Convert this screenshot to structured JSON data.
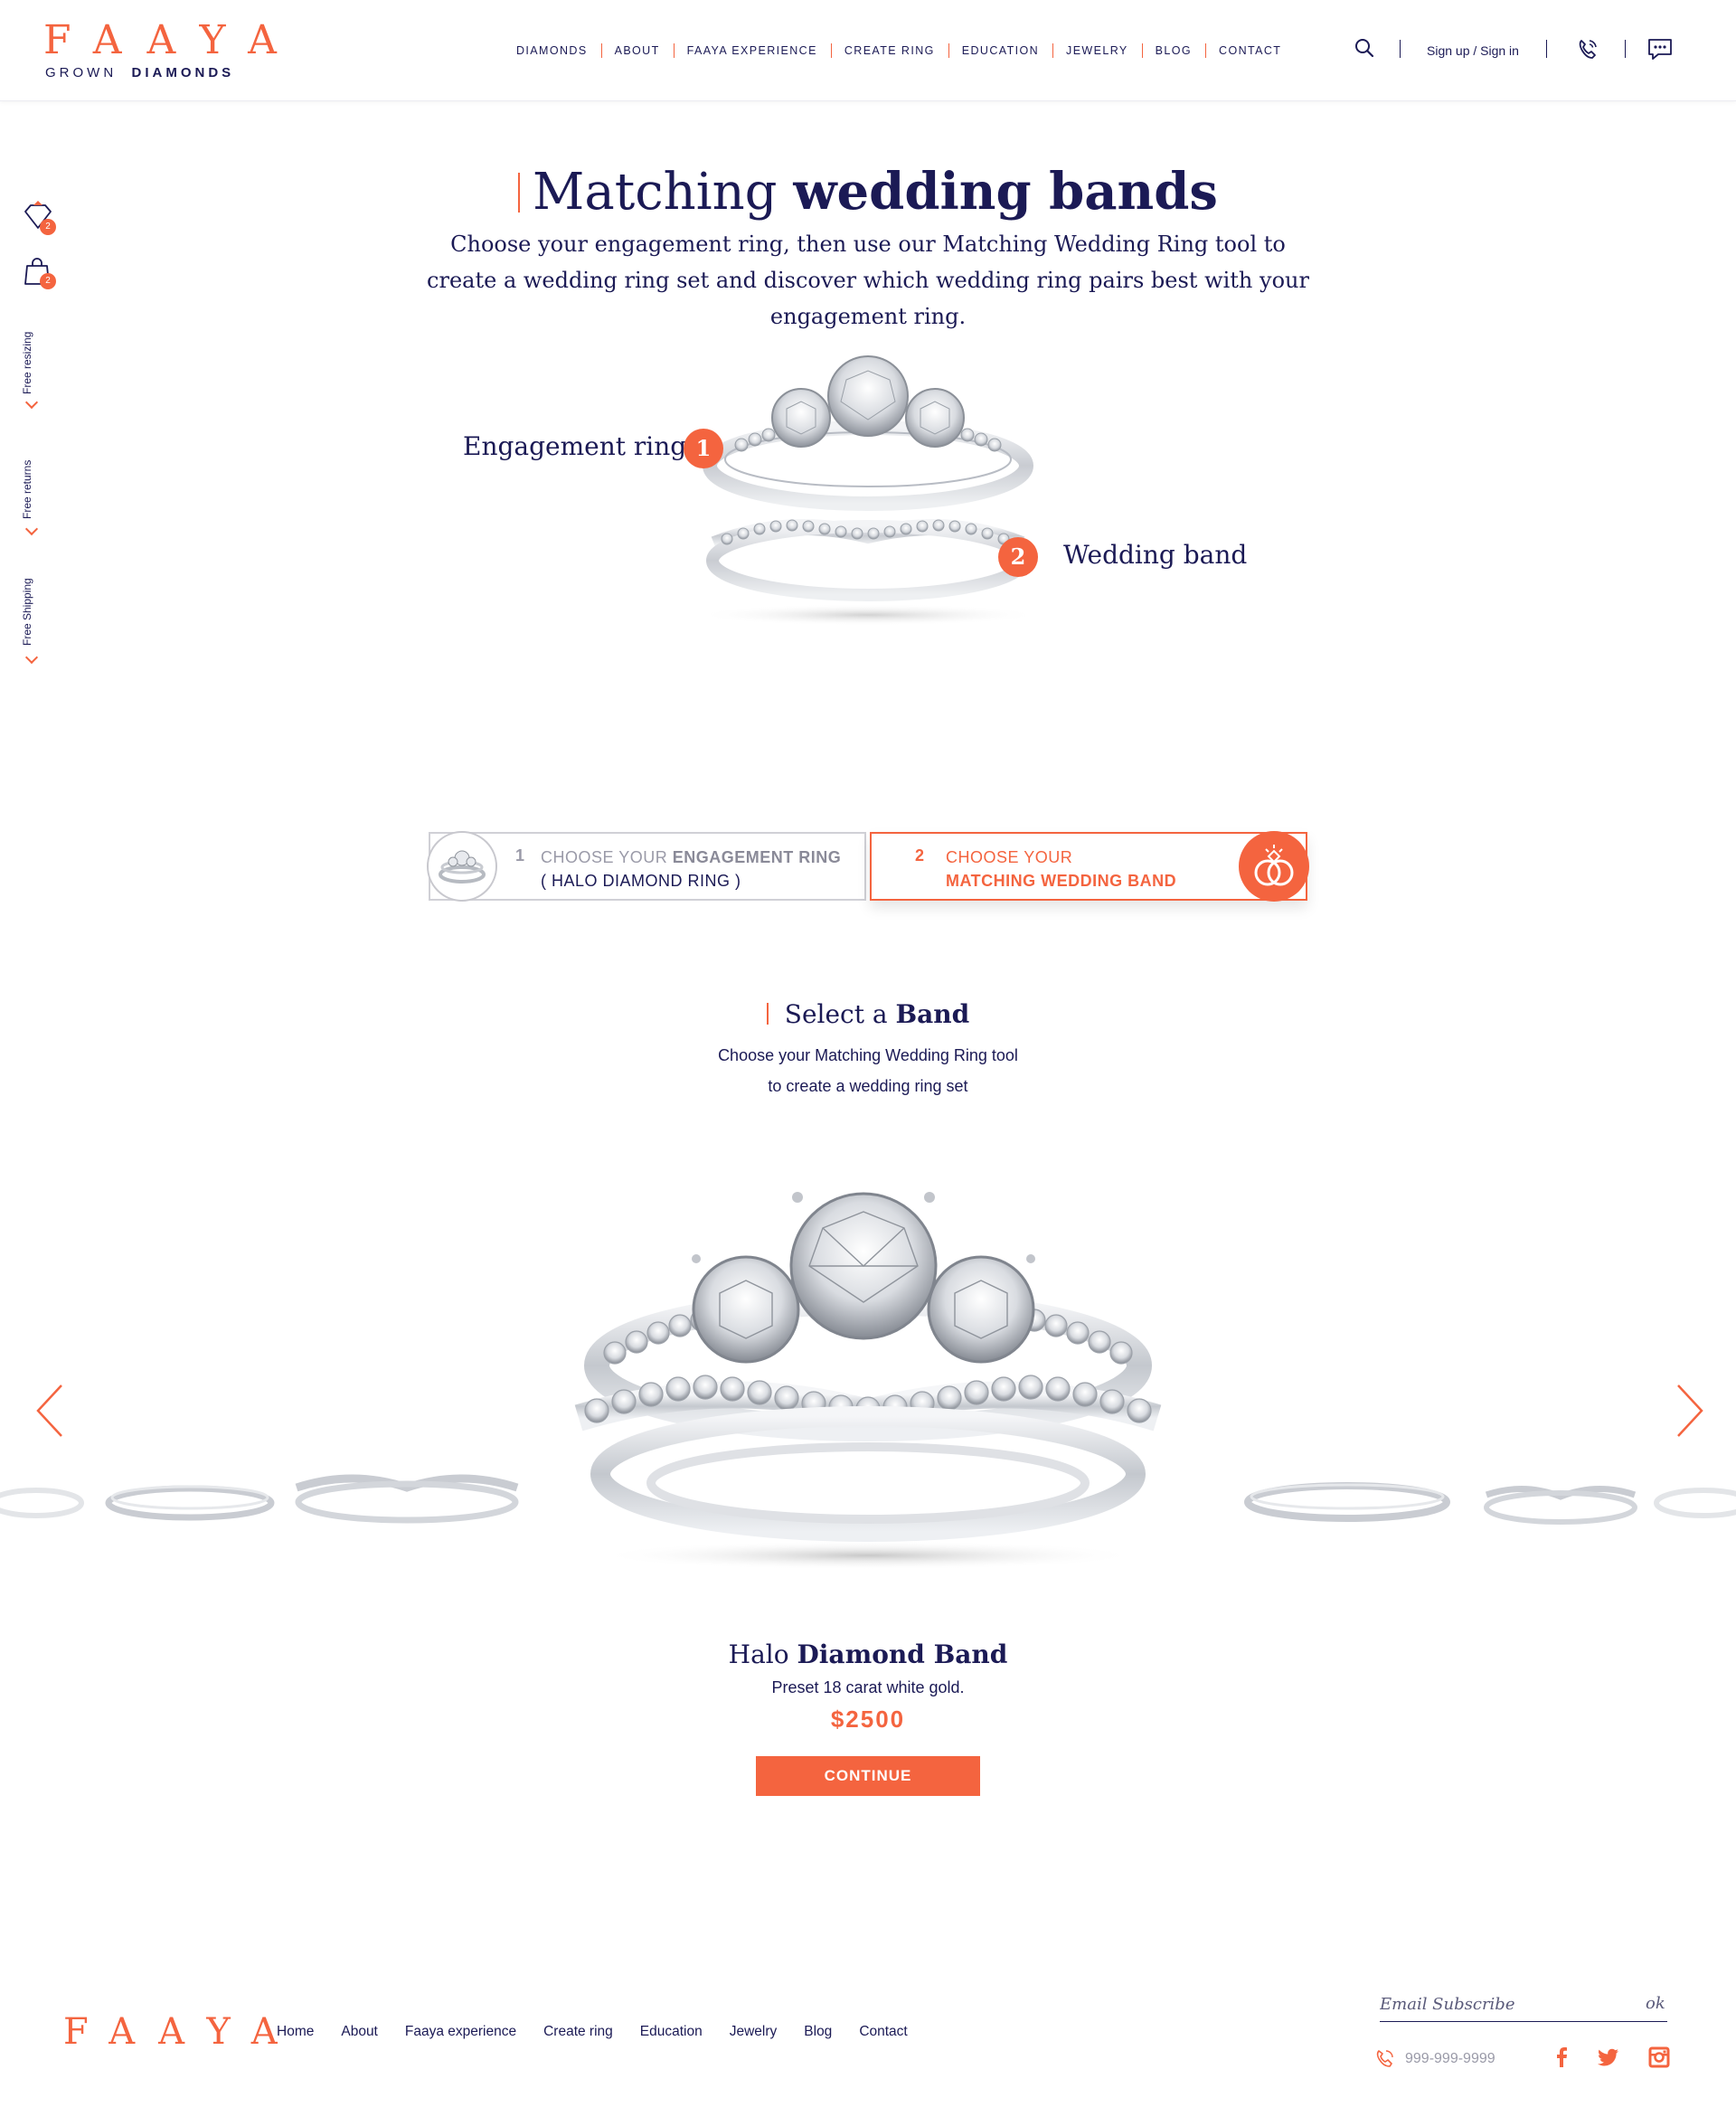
{
  "header": {
    "logo_word": "FAAYA",
    "logo_sub_light": "GROWN",
    "logo_sub_bold": "DIAMONDS",
    "nav": [
      "DIAMONDS",
      "ABOUT",
      "FAAYA EXPERIENCE",
      "CREATE RING",
      "EDUCATION",
      "JEWELRY",
      "BLOG",
      "CONTACT"
    ],
    "signin": "Sign up / Sign in",
    "icons": [
      "search-icon",
      "phone-icon",
      "chat-icon"
    ]
  },
  "rail": {
    "wishlist_count": "2",
    "cart_count": "2",
    "features": [
      "Free resizing",
      "Free returns",
      "Free Shipping"
    ]
  },
  "hero": {
    "title_light": "Matching",
    "title_bold": "wedding bands",
    "description": "Choose your engagement ring, then use our Matching Wedding Ring tool to create a wedding ring set and discover which wedding ring pairs best with your engagement ring.",
    "engagement_label": "Engagement ring",
    "engagement_num": "1",
    "band_label": "Wedding band",
    "band_num": "2"
  },
  "steps": [
    {
      "num": "1",
      "text_light": "CHOOSE YOUR",
      "text_bold": "ENGAGEMENT RING",
      "sub": "( HALO DIAMOND RING )"
    },
    {
      "num": "2",
      "text_light": "CHOOSE YOUR",
      "text_bold": "MATCHING WEDDING BAND"
    }
  ],
  "select": {
    "title_light": "Select a",
    "title_bold": "Band",
    "desc_line1": "Choose your Matching Wedding Ring tool",
    "desc_line2": "to create a wedding ring set"
  },
  "product": {
    "name_light": "Halo",
    "name_bold": "Diamond Band",
    "desc": "Preset 18 carat white gold.",
    "price": "$2500",
    "cta": "CONTINUE"
  },
  "footer": {
    "logo_word": "FAAYA",
    "nav": [
      "Home",
      "About",
      "Faaya experience",
      "Create ring",
      "Education",
      "Jewelry",
      "Blog",
      "Contact"
    ],
    "email_placeholder": "Email Subscribe",
    "email_submit": "ok",
    "phone": "999-999-9999",
    "social": [
      "facebook-icon",
      "twitter-icon",
      "instagram-icon"
    ]
  },
  "colors": {
    "accent": "#f4643f",
    "navy": "#1b1a55",
    "silver": "#d9dade"
  }
}
